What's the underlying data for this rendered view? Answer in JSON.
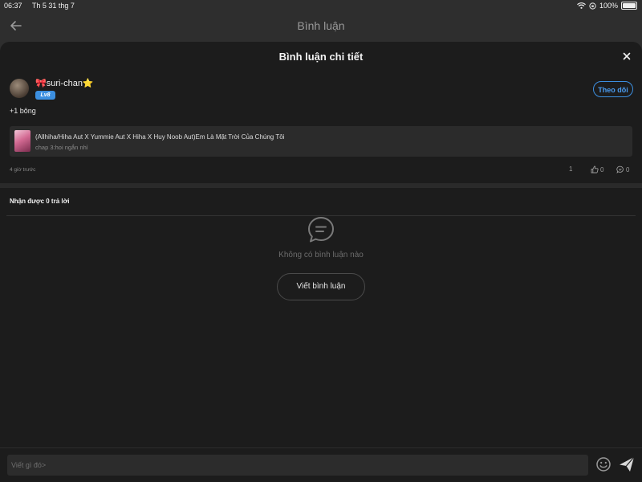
{
  "status_bar": {
    "time": "06:37",
    "date": "Th 5 31 thg 7",
    "battery": "100%"
  },
  "nav": {
    "title": "Bình luận"
  },
  "sheet": {
    "title": "Bình luận chi tiết"
  },
  "comment": {
    "username": "🎀suri-chan⭐",
    "level": "Lv8",
    "follow_label": "Theo dõi",
    "text": "+1 bông",
    "story": {
      "title": "(Allhiha/Hiha Aut X Yummie Aut X Hiha X Huy Noob Aut)Em Là Mặt Trời Của Chúng Tôi",
      "chapter": "chap 3:hoi ngắn nhỉ"
    },
    "time_ago": "4 giờ trước",
    "stats": {
      "first": "1",
      "likes": "0",
      "replies": "0"
    }
  },
  "replies": {
    "header": "Nhận được 0 trả lời",
    "empty_text": "Không có bình luận nào",
    "write_label": "Viết bình luận"
  },
  "input": {
    "placeholder": "Viết gì đó>"
  },
  "colors": {
    "accent": "#3c8fe0",
    "sheet_bg": "#1c1c1c",
    "page_bg": "#2e2e2e"
  }
}
